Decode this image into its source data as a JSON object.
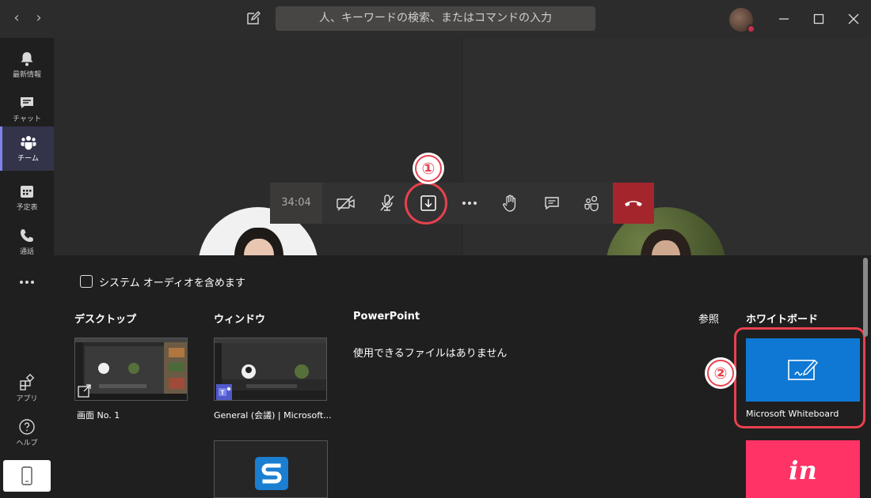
{
  "titlebar": {
    "search_placeholder": "人、キーワードの検索、またはコマンドの入力"
  },
  "sidebar": {
    "items": [
      {
        "label": "最新情報",
        "icon": "bell-icon"
      },
      {
        "label": "チャット",
        "icon": "chat-icon"
      },
      {
        "label": "チーム",
        "icon": "teams-icon",
        "active": true
      },
      {
        "label": "予定表",
        "icon": "calendar-icon"
      },
      {
        "label": "通話",
        "icon": "phone-icon"
      },
      {
        "label": "アプリ",
        "icon": "apps-icon"
      },
      {
        "label": "ヘルプ",
        "icon": "help-icon"
      }
    ]
  },
  "toolbar": {
    "timer": "34:04"
  },
  "annotations": {
    "badge1": "①",
    "badge2": "②"
  },
  "share": {
    "include_audio_label": "システム オーディオを含めます",
    "sections": {
      "desktop": "デスクトップ",
      "window": "ウィンドウ",
      "powerpoint": "PowerPoint",
      "browse": "参照",
      "whiteboard": "ホワイトボード"
    },
    "desktop_caption": "画面 No. 1",
    "window_caption": "General (会議) | Microsoft...",
    "powerpoint_empty": "使用できるファイルはありません",
    "whiteboard_caption": "Microsoft Whiteboard",
    "invision_label": "in"
  },
  "colors": {
    "accent": "#7b83eb",
    "hangup": "#a4262c",
    "whiteboard": "#0f78d4",
    "invision": "#ff3366",
    "highlight": "#e8414f"
  }
}
